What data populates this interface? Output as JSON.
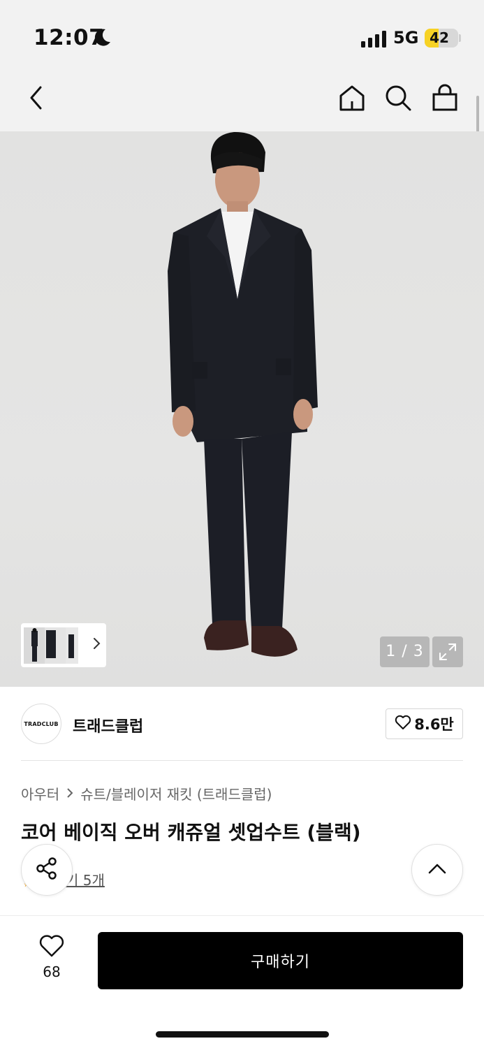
{
  "status_bar": {
    "time": "12:07",
    "network": "5G",
    "battery": "42",
    "battery_level": 0.42,
    "icons": [
      "moon-icon",
      "signal-bars-icon",
      "battery-icon"
    ]
  },
  "nav": {
    "icons": [
      "back-arrow-icon",
      "home-icon",
      "search-icon",
      "shopping-bag-icon"
    ]
  },
  "gallery": {
    "counter": "1 / 3",
    "current": 1,
    "total": 3,
    "expand_icon": "expand-icon"
  },
  "brand": {
    "logo_text": "TRADCLUB",
    "name": "트래드클럽",
    "likes": "8.6만"
  },
  "breadcrumb": {
    "category": "아우터",
    "subcategory": "슈트/블레이저 재킷 (트래드클럽)"
  },
  "product": {
    "title": "코어 베이직 오버 캐쥬얼 셋업수트 (블랙)",
    "review_text": "기 5개"
  },
  "bottom_bar": {
    "wish_count": "68",
    "buy_label": "구매하기"
  },
  "colors": {
    "buy_button": "#000000",
    "battery_fill": "#f7d225",
    "rating_star": "#f5a623"
  }
}
